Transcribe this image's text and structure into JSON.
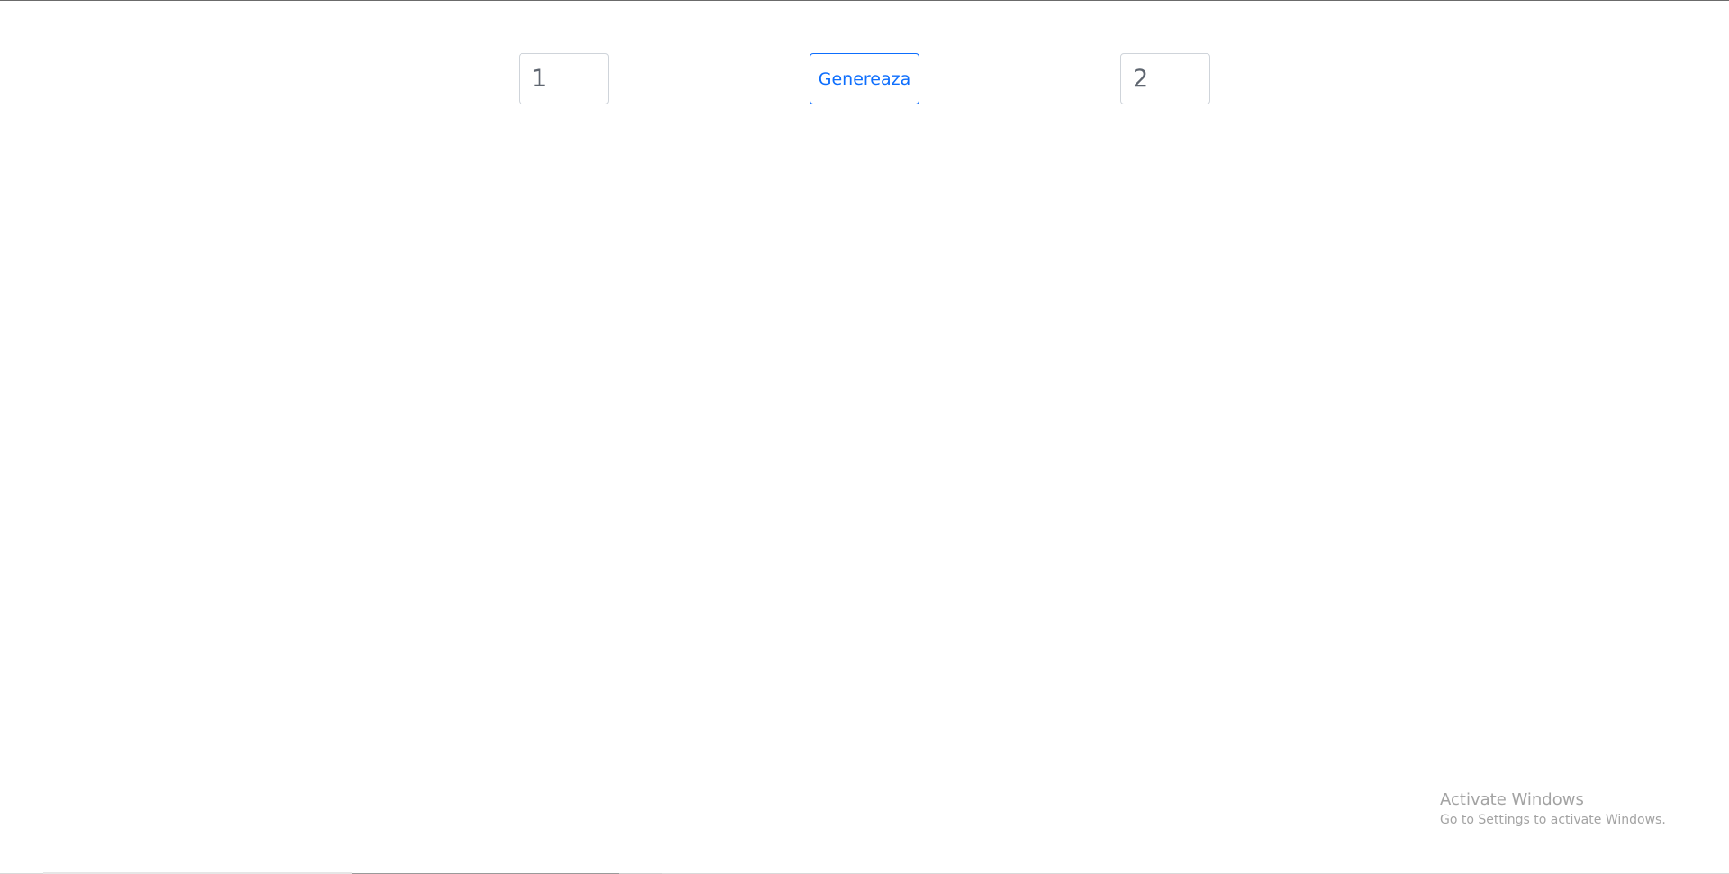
{
  "controls": {
    "left_input_value": "1",
    "generate_label": "Genereaza",
    "right_input_value": "2"
  },
  "watermark": {
    "title": "Activate Windows",
    "subtitle": "Go to Settings to activate Windows."
  },
  "colors": {
    "accent": "#0d6efd",
    "input_border": "#cfd4da",
    "input_text": "#5f6670",
    "watermark_text": "#a3a3a3"
  }
}
